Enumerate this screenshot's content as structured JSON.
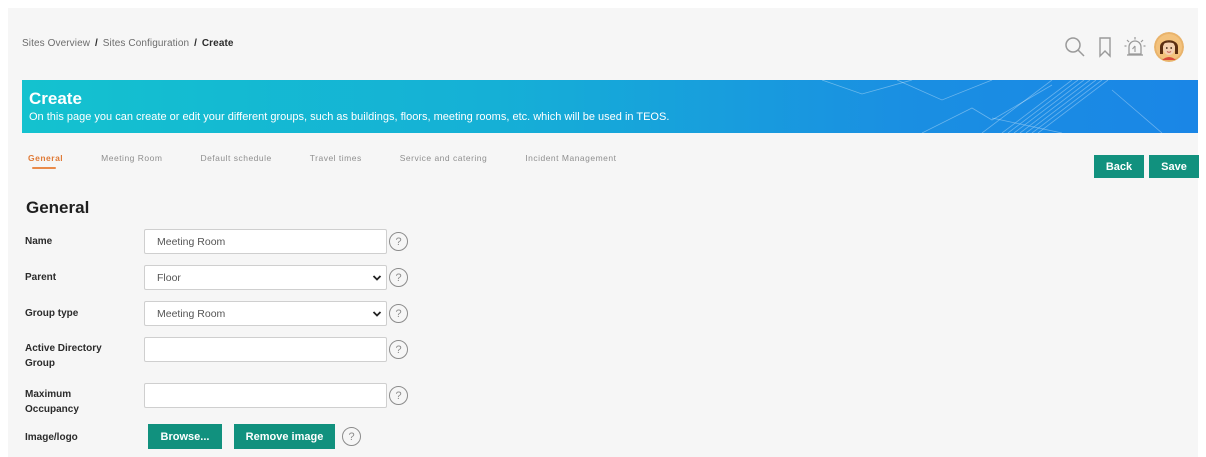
{
  "breadcrumb": {
    "item1": "Sites Overview",
    "sep1": "/",
    "item2": "Sites Configuration",
    "sep2": "/",
    "current": "Create"
  },
  "top_icons": [
    "search-icon",
    "bookmark-icon",
    "alarm-icon",
    "avatar"
  ],
  "banner": {
    "title": "Create",
    "description": "On this page you can create or edit your different groups, such as buildings, floors, meeting rooms, etc. which will be used in TEOS."
  },
  "tabs": [
    {
      "label": "General",
      "active": true
    },
    {
      "label": "Meeting Room",
      "active": false
    },
    {
      "label": "Default schedule",
      "active": false
    },
    {
      "label": "Travel times",
      "active": false
    },
    {
      "label": "Service and catering",
      "active": false
    },
    {
      "label": "Incident Management",
      "active": false
    }
  ],
  "actions": {
    "back": "Back",
    "save": "Save"
  },
  "section_title": "General",
  "form": {
    "name": {
      "label": "Name",
      "value": "Meeting Room"
    },
    "parent": {
      "label": "Parent",
      "value": "Floor"
    },
    "group_type": {
      "label": "Group type",
      "value": "Meeting Room"
    },
    "ad_group": {
      "label_line1": "Active Directory",
      "label_line2": "Group",
      "value": ""
    },
    "max_occupancy": {
      "label_line1": "Maximum",
      "label_line2": "Occupancy",
      "value": ""
    },
    "image": {
      "label": "Image/logo",
      "browse": "Browse...",
      "remove": "Remove image"
    },
    "help_glyph": "?"
  },
  "colors": {
    "accent_green": "#11917e",
    "active_tab": "#e07a36",
    "banner_start": "#14c2cf",
    "banner_end": "#1a86e6"
  }
}
